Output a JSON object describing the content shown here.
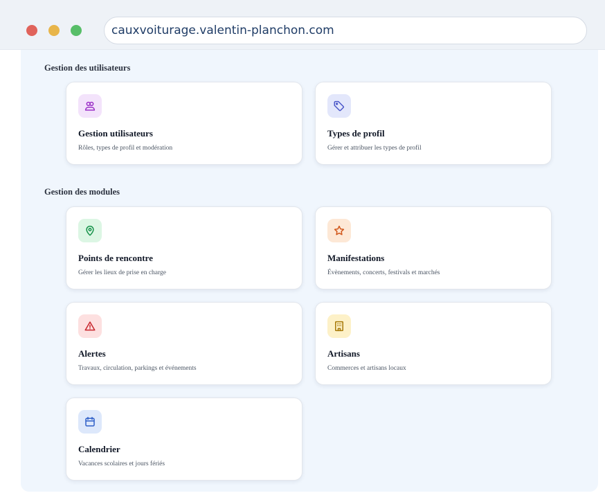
{
  "browser": {
    "url": "cauxvoiturage.valentin-planchon.com"
  },
  "sections": [
    {
      "title": "Gestion des utilisateurs"
    },
    {
      "title": "Gestion des modules"
    }
  ],
  "cards": [
    {
      "title": "Gestion utilisateurs",
      "description": "Rôles, types de profil et modération",
      "icon": "users-icon",
      "icon_bg": "#f3e3fb",
      "icon_color": "#9b2fc7"
    },
    {
      "title": "Types de profil",
      "description": "Gérer et attribuer les types de profil",
      "icon": "tag-icon",
      "icon_bg": "#e3e7fb",
      "icon_color": "#4b57c9"
    },
    {
      "title": "Points de rencontre",
      "description": "Gérer les lieux de prise en charge",
      "icon": "map-pin-icon",
      "icon_bg": "#dcf6e4",
      "icon_color": "#16924a"
    },
    {
      "title": "Manifestations",
      "description": "Évènements, concerts, festivals et marchés",
      "icon": "star-icon",
      "icon_bg": "#fde8d6",
      "icon_color": "#d1561a"
    },
    {
      "title": "Alertes",
      "description": "Travaux, circulation, parkings et événements",
      "icon": "alert-triangle-icon",
      "icon_bg": "#fde0e0",
      "icon_color": "#c8262d"
    },
    {
      "title": "Artisans",
      "description": "Commerces et artisans locaux",
      "icon": "building-icon",
      "icon_bg": "#fdf1c8",
      "icon_color": "#a67806"
    },
    {
      "title": "Calendrier",
      "description": "Vacances scolaires et jours fériés",
      "icon": "calendar-icon",
      "icon_bg": "#dde8fb",
      "icon_color": "#2f5fc8"
    }
  ]
}
